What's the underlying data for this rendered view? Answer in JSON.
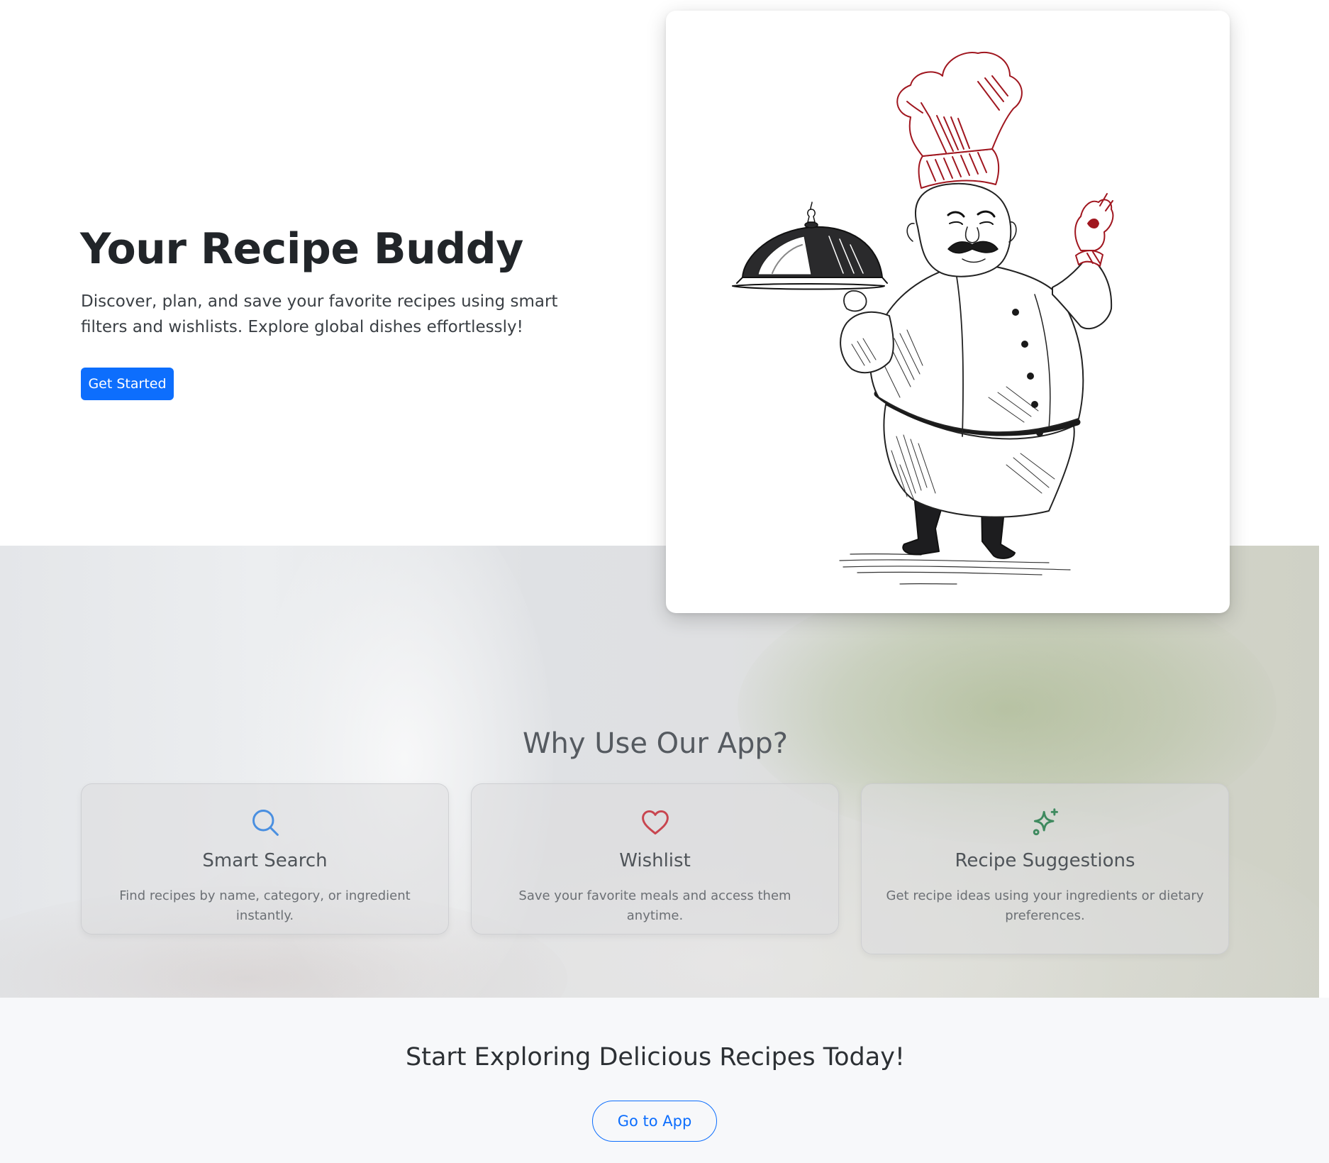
{
  "hero": {
    "title": "Your Recipe Buddy",
    "description": "Discover, plan, and save your favorite recipes using smart filters and wishlists. Explore global dishes effortlessly!",
    "cta_label": "Get Started",
    "image_icon": "chef-illustration"
  },
  "features": {
    "heading": "Why Use Our App?",
    "items": [
      {
        "title": "Smart Search",
        "description": "Find recipes by name, category, or ingredient instantly.",
        "icon": "search-icon",
        "icon_color": "#4a8fe0"
      },
      {
        "title": "Wishlist",
        "description": "Save your favorite meals and access them anytime.",
        "icon": "heart-icon",
        "icon_color": "#c8454f"
      },
      {
        "title": "Recipe Suggestions",
        "description": "Get recipe ideas using your ingredients or dietary preferences.",
        "icon": "stars-icon",
        "icon_color": "#3f8a5f"
      }
    ]
  },
  "cta": {
    "heading": "Start Exploring Delicious Recipes Today!",
    "button_label": "Go to App"
  },
  "colors": {
    "primary": "#0d6efd",
    "chef_hat": "#a0161f"
  }
}
